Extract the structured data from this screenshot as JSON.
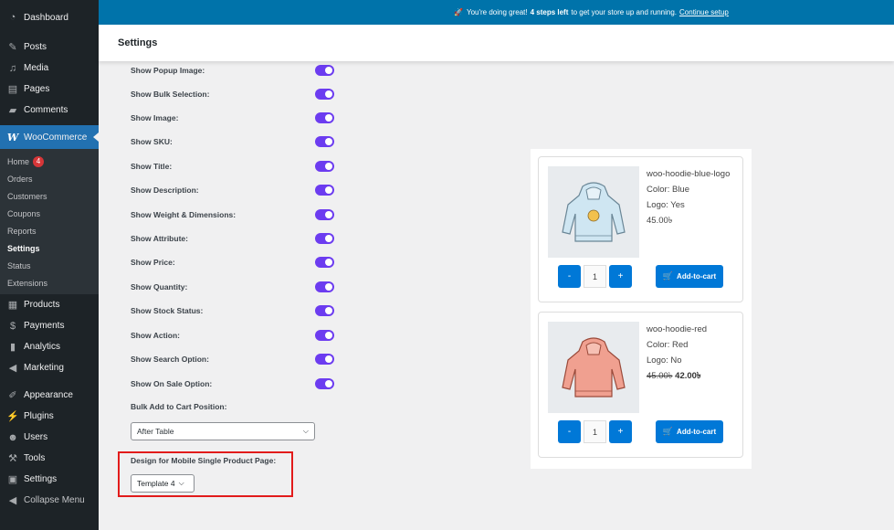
{
  "sidebar": {
    "items": [
      {
        "label": "Dashboard",
        "icon": "dashboard-icon"
      },
      {
        "label": "Posts",
        "icon": "pin-icon"
      },
      {
        "label": "Media",
        "icon": "media-icon"
      },
      {
        "label": "Pages",
        "icon": "pages-icon"
      },
      {
        "label": "Comments",
        "icon": "comments-icon"
      },
      {
        "label": "WooCommerce",
        "icon": "woocommerce-icon"
      },
      {
        "label": "Products",
        "icon": "products-icon"
      },
      {
        "label": "Payments",
        "icon": "payments-icon"
      },
      {
        "label": "Analytics",
        "icon": "analytics-icon"
      },
      {
        "label": "Marketing",
        "icon": "marketing-icon"
      },
      {
        "label": "Appearance",
        "icon": "appearance-icon"
      },
      {
        "label": "Plugins",
        "icon": "plugins-icon"
      },
      {
        "label": "Users",
        "icon": "users-icon"
      },
      {
        "label": "Tools",
        "icon": "tools-icon"
      },
      {
        "label": "Settings",
        "icon": "settings-icon"
      },
      {
        "label": "Collapse Menu",
        "icon": "collapse-icon"
      }
    ],
    "woo_submenu": [
      {
        "label": "Home",
        "badge": "4"
      },
      {
        "label": "Orders"
      },
      {
        "label": "Customers"
      },
      {
        "label": "Coupons"
      },
      {
        "label": "Reports"
      },
      {
        "label": "Settings"
      },
      {
        "label": "Status"
      },
      {
        "label": "Extensions"
      }
    ]
  },
  "notice": {
    "prefix": "You're doing great!",
    "bold": "4 steps left",
    "middle": "to get your store up and running.",
    "link": "Continue setup"
  },
  "header": {
    "title": "Settings"
  },
  "settings": {
    "toggles": [
      {
        "label": "Show Popup Image:",
        "on": true
      },
      {
        "label": "Show Bulk Selection:",
        "on": true
      },
      {
        "label": "Show Image:",
        "on": true
      },
      {
        "label": "Show SKU:",
        "on": true
      },
      {
        "label": "Show Title:",
        "on": true
      },
      {
        "label": "Show Description:",
        "on": true
      },
      {
        "label": "Show Weight & Dimensions:",
        "on": true
      },
      {
        "label": "Show Attribute:",
        "on": true
      },
      {
        "label": "Show Price:",
        "on": true
      },
      {
        "label": "Show Quantity:",
        "on": true
      },
      {
        "label": "Show Stock Status:",
        "on": true
      },
      {
        "label": "Show Action:",
        "on": true
      },
      {
        "label": "Show Search Option:",
        "on": true
      },
      {
        "label": "Show On Sale Option:",
        "on": true
      }
    ],
    "bulk_label": "Bulk Add to Cart Position:",
    "bulk_value": "After Table",
    "mobile_label": "Design for Mobile Single Product Page:",
    "mobile_value": "Template 4"
  },
  "preview": {
    "products": [
      {
        "name": "woo-hoodie-blue-logo",
        "color": "Color: Blue",
        "logo": "Logo: Yes",
        "price": "45.00৳",
        "old_price": "",
        "qty": "1",
        "button": "Add-to-cart",
        "hoodie_color": "#cfe6f2"
      },
      {
        "name": "woo-hoodie-red",
        "color": "Color: Red",
        "logo": "Logo: No",
        "price": "42.00৳",
        "old_price": "45.00৳",
        "qty": "1",
        "button": "Add-to-cart",
        "hoodie_color": "#f0a090"
      }
    ],
    "minus": "-",
    "plus": "+"
  },
  "colors": {
    "toggle": "#6c3cf0",
    "accent": "#0078d7",
    "sidebar": "#1d2327",
    "notice": "#0073aa",
    "highlight": "#e21b1b"
  }
}
